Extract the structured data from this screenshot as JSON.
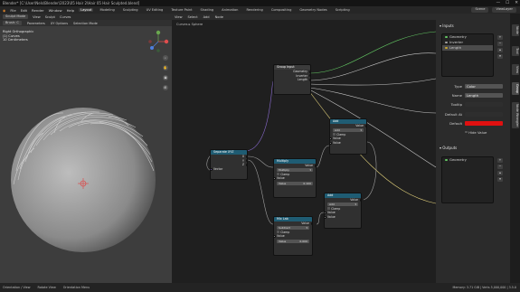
{
  "window": {
    "title": "Blender* [C:\\User\\Nels\\Blender\\2023\\05 Hair 2\\Hair 05 Hair Sculpted.blend]",
    "controls": [
      "—",
      "☐",
      "✕"
    ]
  },
  "menu": {
    "items": [
      "File",
      "Edit",
      "Render",
      "Window",
      "Help"
    ],
    "tabs": [
      "Layout",
      "Modeling",
      "Sculpting",
      "UV Editing",
      "Texture Paint",
      "Shading",
      "Animation",
      "Rendering",
      "Compositing",
      "Geometry Nodes",
      "Scripting"
    ],
    "active_tab": "Layout",
    "scene": "Scene",
    "view_layer": "ViewLayer"
  },
  "viewport": {
    "header1": {
      "mode": "Sculpt Mode",
      "items": [
        "View",
        "Sculpt",
        "Curves"
      ]
    },
    "header2": {
      "items": [
        "Brush: C",
        "Parameters",
        "XY Options",
        "Selection Mode"
      ]
    },
    "info": {
      "line1": "Right Orthographic",
      "line2": "(1) Curves",
      "line3": "10 Centimeters"
    },
    "tool_icons": [
      "zoom-icon",
      "hand-icon",
      "camera-icon",
      "grid-icon"
    ]
  },
  "node_editor": {
    "header": {
      "items": [
        "View",
        "Select",
        "Add",
        "Node"
      ]
    },
    "breadcrumb": "Curves ▸ Sphere",
    "nodes": {
      "group_input": {
        "title": "Group Input",
        "outputs": [
          "Geometry",
          "Inverter",
          "Length"
        ]
      },
      "reroute_hint": {
        "title": "Separate XYZ"
      },
      "math1": {
        "title": "Multiply",
        "outputs": [
          "Value"
        ],
        "op": "Multiply",
        "clamp": "Clamp",
        "field_label": "Value",
        "field_value": "0.100"
      },
      "math2": {
        "title": "Add",
        "outputs": [
          "Value"
        ],
        "op": "Add",
        "clamp": "Clamp",
        "inputs": [
          "Value",
          "Value"
        ]
      },
      "math3": {
        "title": "Mix Lab",
        "op": "Subtract",
        "clamp": "Clamp",
        "field_label": "Value",
        "field_value": "0.000"
      },
      "math4": {
        "title": "Add",
        "op": "Add",
        "clamp": "Clamp",
        "inputs": [
          "Value",
          "Value"
        ]
      },
      "sep": {
        "title": "Separate XYZ",
        "outputs": [
          "X",
          "Y",
          "Z"
        ],
        "input": "Vector"
      }
    }
  },
  "npanel": {
    "inputs_header": "Inputs",
    "inputs": [
      {
        "name": "Geometry",
        "color": "#63c763"
      },
      {
        "name": "Inverter",
        "color": "#a0a0a0"
      },
      {
        "name": "Length",
        "color": "#c7a52e"
      }
    ],
    "props": {
      "type_label": "Type",
      "type_value": "Color",
      "name_label": "Name",
      "name_value": "Length",
      "tooltip_label": "Tooltip",
      "default_label": "Default",
      "default_color": "#e01010",
      "hide_value": "Hide Value",
      "default_attr_label": "Default At"
    },
    "outputs_header": "Outputs",
    "outputs": [
      {
        "name": "Geometry",
        "color": "#63c763"
      }
    ],
    "tabs": [
      "Node",
      "Tool",
      "View",
      "Group",
      "Node Wrangler"
    ],
    "active_tab": "Group"
  },
  "status": {
    "left": [
      "Orientation / View",
      "Rotate View",
      "Orientation Menu"
    ],
    "right": "Memory: 3.71 GiB | Verts 5,000,000 | 3.5.0"
  }
}
